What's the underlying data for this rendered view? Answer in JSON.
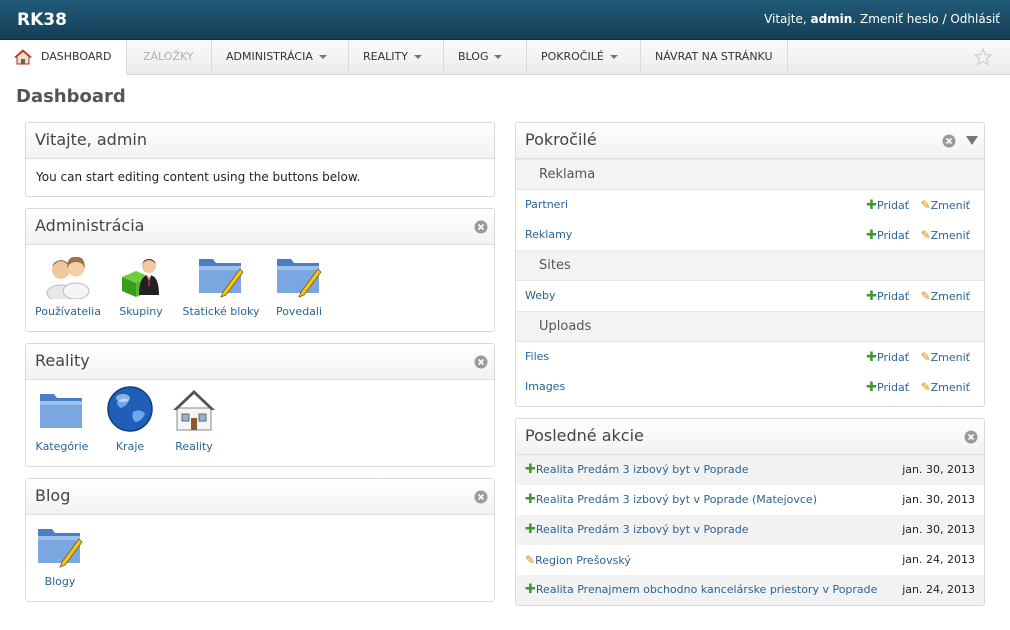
{
  "header": {
    "brand": "RK38",
    "welcome": "Vitajte,",
    "username": "admin",
    "change_password": "Zmeniť heslo",
    "separator": "/",
    "logout": "Odhlásiť"
  },
  "nav": {
    "dashboard": "DASHBOARD",
    "bookmarks": "ZÁLOŽKY",
    "administration": "ADMINISTRÁCIA",
    "reality": "REALITY",
    "blog": "BLOG",
    "advanced": "POKROČILÉ",
    "back_to_site": "NÁVRAT NA STRÁNKU"
  },
  "page_title": "Dashboard",
  "welcome_module": {
    "title": "Vitajte, admin",
    "text": "You can start editing content using the buttons below."
  },
  "admin_module": {
    "title": "Administrácia",
    "items": [
      "Používatelia",
      "Skupiny",
      "Statické bloky",
      "Povedali"
    ]
  },
  "reality_module": {
    "title": "Reality",
    "items": [
      "Kategórie",
      "Kraje",
      "Reality"
    ]
  },
  "blog_module": {
    "title": "Blog",
    "items": [
      "Blogy"
    ]
  },
  "advanced_module": {
    "title": "Pokročilé",
    "add_label": "Pridať",
    "change_label": "Zmeniť",
    "groups": [
      {
        "name": "Reklama",
        "apps": [
          "Partneri",
          "Reklamy"
        ]
      },
      {
        "name": "Sites",
        "apps": [
          "Weby"
        ]
      },
      {
        "name": "Uploads",
        "apps": [
          "Files",
          "Images"
        ]
      }
    ]
  },
  "recent_module": {
    "title": "Posledné akcie",
    "rows": [
      {
        "type": "add",
        "text": "Realita Predám 3 izbový byt v Poprade",
        "date": "jan. 30, 2013"
      },
      {
        "type": "add",
        "text": "Realita Predám 3 izbový byt v Poprade (Matejovce)",
        "date": "jan. 30, 2013"
      },
      {
        "type": "add",
        "text": "Realita Predám 3 izbový byt v Poprade",
        "date": "jan. 30, 2013"
      },
      {
        "type": "change",
        "text": "Region Prešovský",
        "date": "jan. 24, 2013"
      },
      {
        "type": "add",
        "text": "Realita Prenajmem obchodno kancelárske priestory v Poprade",
        "date": "jan. 24, 2013"
      }
    ]
  }
}
